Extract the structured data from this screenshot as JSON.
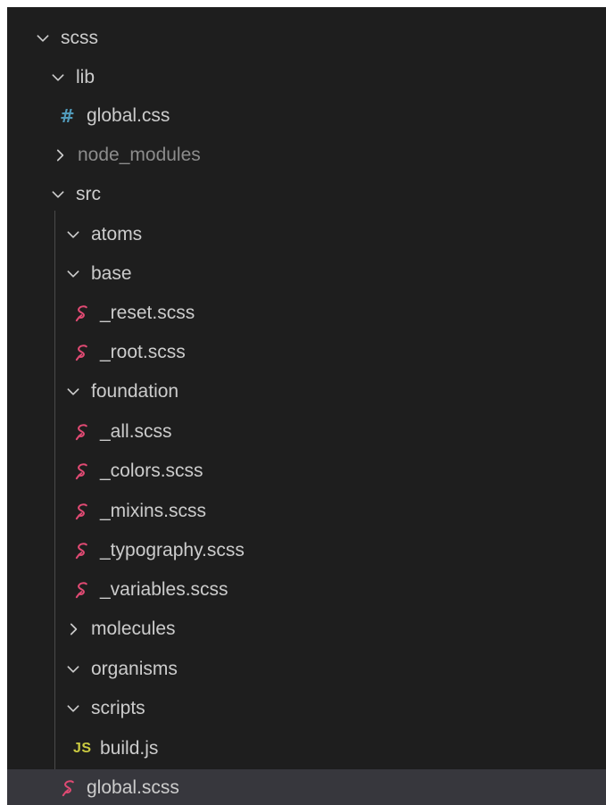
{
  "explorer": {
    "items": [
      {
        "label": "scss",
        "type": "folder",
        "state": "expanded",
        "depth": 0,
        "icon": "chevron-down-icon"
      },
      {
        "label": "lib",
        "type": "folder",
        "state": "expanded",
        "depth": 1,
        "icon": "chevron-down-icon"
      },
      {
        "label": "global.css",
        "type": "file",
        "depth": 2,
        "icon": "css-hash-icon",
        "icon_glyph": "#"
      },
      {
        "label": "node_modules",
        "type": "folder",
        "state": "collapsed",
        "depth": 1,
        "icon": "chevron-right-icon",
        "dimmed": true
      },
      {
        "label": "src",
        "type": "folder",
        "state": "expanded",
        "depth": 1,
        "icon": "chevron-down-icon"
      },
      {
        "label": "atoms",
        "type": "folder",
        "state": "expanded",
        "depth": 2,
        "icon": "chevron-down-icon"
      },
      {
        "label": "base",
        "type": "folder",
        "state": "expanded",
        "depth": 2,
        "icon": "chevron-down-icon"
      },
      {
        "label": "_reset.scss",
        "type": "file",
        "depth": 3,
        "icon": "sass-icon"
      },
      {
        "label": "_root.scss",
        "type": "file",
        "depth": 3,
        "icon": "sass-icon"
      },
      {
        "label": "foundation",
        "type": "folder",
        "state": "expanded",
        "depth": 2,
        "icon": "chevron-down-icon"
      },
      {
        "label": "_all.scss",
        "type": "file",
        "depth": 3,
        "icon": "sass-icon"
      },
      {
        "label": "_colors.scss",
        "type": "file",
        "depth": 3,
        "icon": "sass-icon"
      },
      {
        "label": "_mixins.scss",
        "type": "file",
        "depth": 3,
        "icon": "sass-icon"
      },
      {
        "label": "_typography.scss",
        "type": "file",
        "depth": 3,
        "icon": "sass-icon"
      },
      {
        "label": "_variables.scss",
        "type": "file",
        "depth": 3,
        "icon": "sass-icon"
      },
      {
        "label": "molecules",
        "type": "folder",
        "state": "collapsed",
        "depth": 2,
        "icon": "chevron-right-icon"
      },
      {
        "label": "organisms",
        "type": "folder",
        "state": "expanded",
        "depth": 2,
        "icon": "chevron-down-icon"
      },
      {
        "label": "scripts",
        "type": "folder",
        "state": "expanded",
        "depth": 2,
        "icon": "chevron-down-icon"
      },
      {
        "label": "build.js",
        "type": "file",
        "depth": 3,
        "icon": "javascript-icon",
        "icon_glyph": "JS"
      },
      {
        "label": "global.scss",
        "type": "file",
        "depth": 2,
        "icon": "sass-icon",
        "selected": true
      }
    ]
  },
  "colors": {
    "background": "#1e1e1e",
    "text": "#cccccc",
    "text_dimmed": "#8c8c8c",
    "selection": "#37373d",
    "indent_guide": "#4a4a4a",
    "css_icon": "#519aba",
    "sass_icon": "#e04a73",
    "js_icon": "#cbcb41"
  }
}
